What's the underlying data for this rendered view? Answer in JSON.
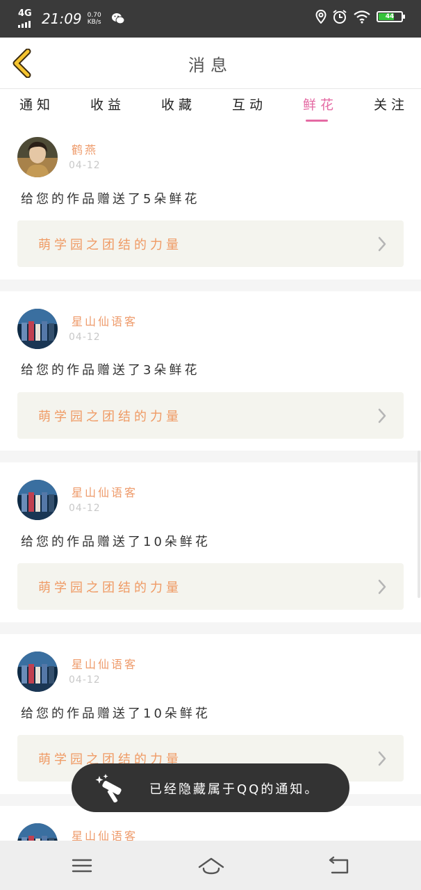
{
  "status_bar": {
    "network": "4G",
    "time": "21:09",
    "speed_value": "0.70",
    "speed_unit": "KB/s",
    "battery": "44",
    "battery_color": "#35c23a"
  },
  "header": {
    "title": "消息"
  },
  "tabs": [
    {
      "label": "通知",
      "active": false
    },
    {
      "label": "收益",
      "active": false
    },
    {
      "label": "收藏",
      "active": false
    },
    {
      "label": "互动",
      "active": false
    },
    {
      "label": "鲜花",
      "active": true
    },
    {
      "label": "关注",
      "active": false
    }
  ],
  "accent_color": "#e46aa3",
  "notifications": [
    {
      "user": "鹤燕",
      "date": "04-12",
      "message": "给您的作品赠送了5朵鲜花",
      "work": "萌学园之团结的力量"
    },
    {
      "user": "星山仙语客",
      "date": "04-12",
      "message": "给您的作品赠送了3朵鲜花",
      "work": "萌学园之团结的力量"
    },
    {
      "user": "星山仙语客",
      "date": "04-12",
      "message": "给您的作品赠送了10朵鲜花",
      "work": "萌学园之团结的力量"
    },
    {
      "user": "星山仙语客",
      "date": "04-12",
      "message": "给您的作品赠送了10朵鲜花",
      "work": "萌学园之团结的力量"
    },
    {
      "user": "星山仙语客",
      "date": "",
      "message": "",
      "work": ""
    }
  ],
  "toast": {
    "text": "已经隐藏属于QQ的通知。"
  },
  "navbar": {
    "icons": [
      "menu-icon",
      "home-icon",
      "back-icon"
    ]
  }
}
